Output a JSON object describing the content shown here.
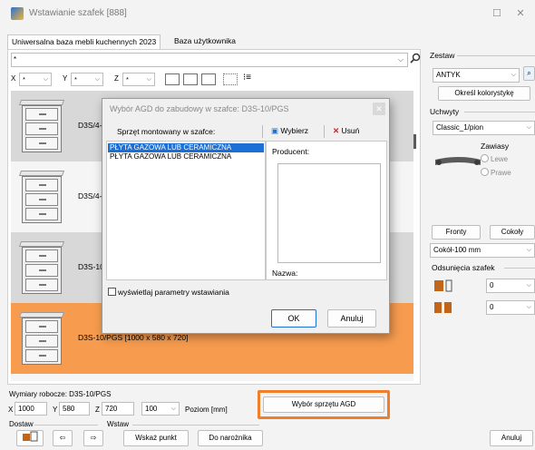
{
  "window": {
    "title": "Wstawianie szafek [888]"
  },
  "tabs": [
    {
      "label": "Uniwersalna baza mebli kuchennych 2023"
    },
    {
      "label": "Baza użytkownika"
    }
  ],
  "search": {
    "value": "*"
  },
  "filters": [
    {
      "label": "X",
      "value": "*"
    },
    {
      "label": "Y",
      "value": "*"
    },
    {
      "label": "Z",
      "value": "*"
    }
  ],
  "list": {
    "rows": [
      {
        "text": "D3S/4-S"
      },
      {
        "text": "D3S/4-S"
      },
      {
        "text": "D3S-10"
      },
      {
        "text": "D3S-10/PGS  [1000 x 580 x 720]"
      }
    ]
  },
  "dialog": {
    "title": "Wybór AGD do zabudowy w szafce: D3S-10/PGS",
    "header_label": "Sprzęt montowany w szafce:",
    "choose_label": "Wybierz",
    "delete_label": "Usuń",
    "items": [
      "PŁYTA GAZOWA LUB CERAMICZNA",
      "PŁYTA GAZOWA LUB CERAMICZNA"
    ],
    "producer_label": "Producent:",
    "name_label": "Nazwa:",
    "checkbox_label": "wyświetlaj parametry wstawiania",
    "ok_label": "OK",
    "cancel_label": "Anuluj"
  },
  "right": {
    "zestaw_label": "Zestaw",
    "zestaw_value": "ANTYK",
    "kolorystyka_button": "Określ kolorystykę",
    "uchwyty_label": "Uchwyty",
    "uchwyty_value": "Classic_1/pion",
    "zawiasy_label": "Zawiasy",
    "lewe_label": "Lewe",
    "prawe_label": "Prawe",
    "fronty_button": "Fronty",
    "cokoly_button": "Cokoły",
    "cokol_value": "Cokół-100 mm",
    "odsuniecia_label": "Odsunięcia szafek",
    "odsuniecie1_value": "0",
    "odsuniecie2_value": "0"
  },
  "bottom": {
    "wymiary_label": "Wymiary robocze: D3S-10/PGS",
    "x_label": "X",
    "x_value": "1000",
    "y_label": "Y",
    "y_value": "580",
    "z_label": "Z",
    "z_value": "720",
    "poziom_value": "100",
    "poziom_label": "Poziom [mm]",
    "agd_button": "Wybór sprzętu AGD",
    "dostaw_label": "Dostaw",
    "wstaw_label": "Wstaw",
    "wskaz_button": "Wskaż punkt",
    "naroznik_button": "Do narożnika",
    "anuluj_button": "Anuluj"
  },
  "colors": {
    "accent_orange": "#f79c4f",
    "highlight_outline": "#f07e2b",
    "selection_blue": "#1c6fd4"
  }
}
